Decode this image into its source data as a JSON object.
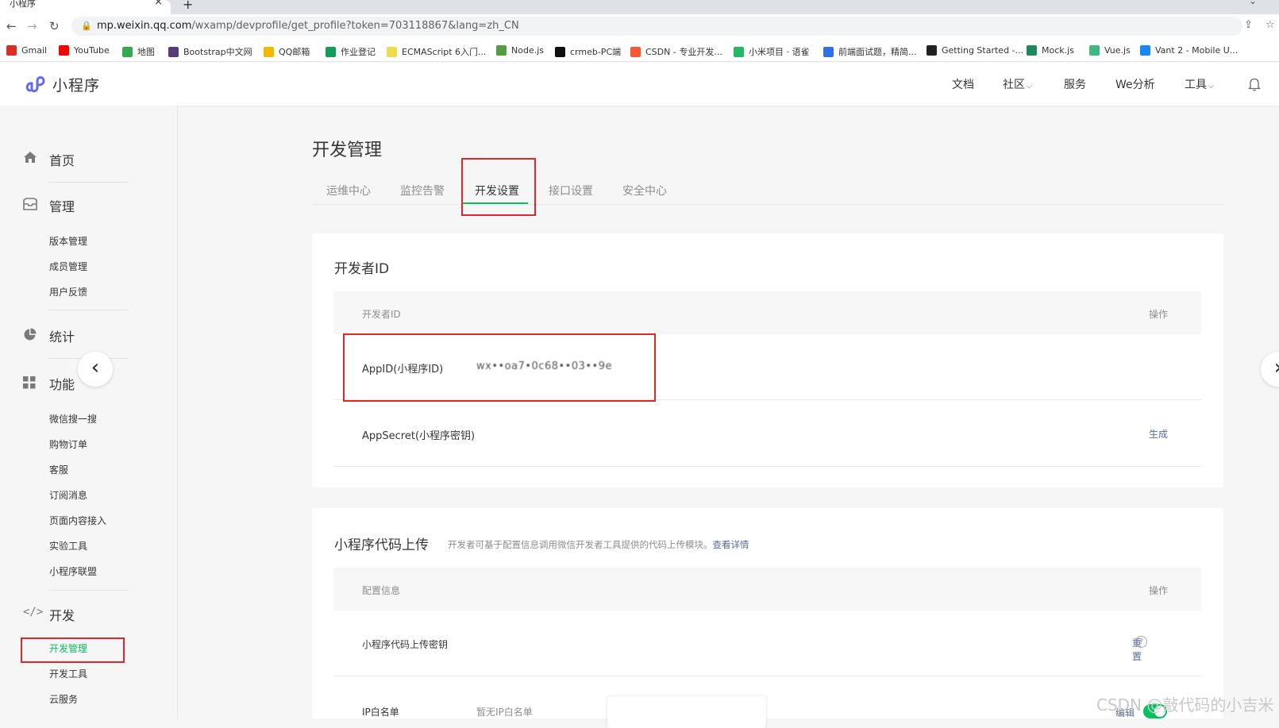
{
  "browser": {
    "tab_title": "小程序",
    "new_tab": "+",
    "url_host": "mp.weixin.qq.com",
    "url_path": "/wxamp/devprofile/get_profile?token=703118867&lang=zh_CN",
    "bookmarks": [
      {
        "label": "Gmail",
        "icon": "gmail-icon",
        "color": "#d93025"
      },
      {
        "label": "YouTube",
        "icon": "youtube-icon",
        "color": "#ff0000"
      },
      {
        "label": "地图",
        "icon": "maps-icon",
        "color": "#34a853"
      },
      {
        "label": "Bootstrap中文网",
        "icon": "bootstrap-icon",
        "color": "#563d7c"
      },
      {
        "label": "QQ邮箱",
        "icon": "qqmail-icon",
        "color": "#f5b700"
      },
      {
        "label": "作业登记",
        "icon": "sheet-icon",
        "color": "#0f9d58"
      },
      {
        "label": "ECMAScript 6入门...",
        "icon": "es-icon",
        "color": "#f0db4f"
      },
      {
        "label": "Node.js",
        "icon": "nodejs-icon",
        "color": "#539e43"
      },
      {
        "label": "crmeb-PC端",
        "icon": "crmeb-icon",
        "color": "#111111"
      },
      {
        "label": "CSDN - 专业开发...",
        "icon": "csdn-icon",
        "color": "#fc5531"
      },
      {
        "label": "小米项目 · 语雀",
        "icon": "yuque-icon",
        "color": "#25b864"
      },
      {
        "label": "前端面试题，精简...",
        "icon": "doc-icon",
        "color": "#2f6fed"
      },
      {
        "label": "Getting Started -...",
        "icon": "github-icon",
        "color": "#222222"
      },
      {
        "label": "Mock.js",
        "icon": "mock-icon",
        "color": "#1e8a5a"
      },
      {
        "label": "Vue.js",
        "icon": "vue-icon",
        "color": "#41b883"
      },
      {
        "label": "Vant 2 - Mobile U...",
        "icon": "vant-icon",
        "color": "#1989fa"
      }
    ]
  },
  "header": {
    "logo_text": "小程序",
    "nav": [
      "文档",
      "社区",
      "服务",
      "We分析",
      "工具"
    ]
  },
  "sidebar": {
    "home": "首页",
    "manage": "管理",
    "manage_items": [
      "版本管理",
      "成员管理",
      "用户反馈"
    ],
    "stats": "统计",
    "features": "功能",
    "feature_items": [
      "微信搜一搜",
      "购物订单",
      "客服",
      "订阅消息",
      "页面内容接入",
      "实验工具",
      "小程序联盟"
    ],
    "dev": "开发",
    "dev_items": [
      "开发管理",
      "开发工具",
      "云服务"
    ]
  },
  "page": {
    "title": "开发管理",
    "tabs": [
      "运维中心",
      "监控告警",
      "开发设置",
      "接口设置",
      "安全中心"
    ],
    "active_tab": "开发设置"
  },
  "dev_id_card": {
    "title": "开发者ID",
    "col_name": "开发者ID",
    "col_op": "操作",
    "appid_label": "AppID(小程序ID)",
    "appid_value": "wx••oa7•0c68••03••9e",
    "appsecret_label": "AppSecret(小程序密钥)",
    "appsecret_action": "生成"
  },
  "upload_card": {
    "title": "小程序代码上传",
    "desc": "开发者可基于配置信息调用微信开发者工具提供的代码上传模块。",
    "desc_link": "查看详情",
    "col_name": "配置信息",
    "col_op": "操作",
    "key_label": "小程序代码上传密钥",
    "key_action": "重置",
    "ip_label": "IP白名单",
    "ip_value": "暂无IP白名单",
    "ip_action": "编辑",
    "toggle_on": true
  },
  "watermark": "CSDN @敲代码的小吉米"
}
